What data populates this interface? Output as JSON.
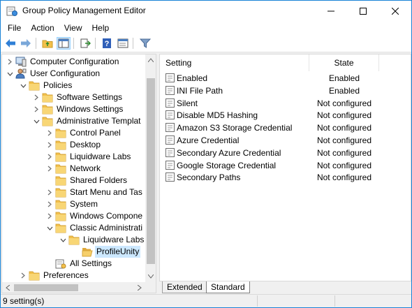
{
  "window": {
    "title": "Group Policy Management Editor",
    "icon": "gpo-editor-icon",
    "controls": [
      "minimize",
      "maximize",
      "close"
    ]
  },
  "menu": [
    "File",
    "Action",
    "View",
    "Help"
  ],
  "toolbar": {
    "buttons": [
      "back-arrow-icon",
      "forward-arrow-icon",
      "up-folder-icon",
      "show-hide-tree-icon",
      "export-list-icon",
      "help-icon",
      "properties-icon",
      "filter-icon"
    ]
  },
  "tree": {
    "items": [
      {
        "label": "Computer Configuration",
        "expanded": false,
        "icon": "computer-icon"
      },
      {
        "label": "User Configuration",
        "expanded": true,
        "icon": "user-icon"
      },
      {
        "label": "Policies",
        "expanded": true,
        "icon": "folder-icon"
      },
      {
        "label": "Software Settings",
        "expanded": false,
        "icon": "folder-icon"
      },
      {
        "label": "Windows Settings",
        "expanded": false,
        "icon": "folder-icon"
      },
      {
        "label": "Administrative Templat",
        "expanded": true,
        "icon": "folder-icon"
      },
      {
        "label": "Control Panel",
        "expanded": false,
        "icon": "folder-icon"
      },
      {
        "label": "Desktop",
        "expanded": false,
        "icon": "folder-icon"
      },
      {
        "label": "Liquidware Labs",
        "expanded": false,
        "icon": "folder-icon"
      },
      {
        "label": "Network",
        "expanded": false,
        "icon": "folder-icon"
      },
      {
        "label": "Shared Folders",
        "expanded": null,
        "icon": "folder-icon"
      },
      {
        "label": "Start Menu and Tas",
        "expanded": false,
        "icon": "folder-icon"
      },
      {
        "label": "System",
        "expanded": false,
        "icon": "folder-icon"
      },
      {
        "label": "Windows Compone",
        "expanded": false,
        "icon": "folder-icon"
      },
      {
        "label": "Classic Administrati",
        "expanded": true,
        "icon": "folder-icon"
      },
      {
        "label": "Liquidware Labs",
        "expanded": true,
        "icon": "folder-icon"
      },
      {
        "label": "ProfileUnity",
        "expanded": null,
        "icon": "folder-open-icon",
        "selected": true
      },
      {
        "label": "All Settings",
        "expanded": null,
        "icon": "all-settings-icon"
      },
      {
        "label": "Preferences",
        "expanded": false,
        "icon": "folder-icon"
      }
    ]
  },
  "list": {
    "columns": [
      "Setting",
      "State"
    ],
    "rows": [
      {
        "setting": "Enabled",
        "state": "Enabled"
      },
      {
        "setting": "INI File Path",
        "state": "Enabled"
      },
      {
        "setting": "Silent",
        "state": "Not configured"
      },
      {
        "setting": "Disable MD5 Hashing",
        "state": "Not configured"
      },
      {
        "setting": "Amazon S3 Storage Credential",
        "state": "Not configured"
      },
      {
        "setting": "Azure Credential",
        "state": "Not configured"
      },
      {
        "setting": "Secondary Azure Credential",
        "state": "Not configured"
      },
      {
        "setting": "Google Storage Credential",
        "state": "Not configured"
      },
      {
        "setting": "Secondary Paths",
        "state": "Not configured"
      }
    ]
  },
  "tabs": [
    "Extended",
    "Standard"
  ],
  "active_tab": "Standard",
  "status": "9 setting(s)",
  "colors": {
    "accent": "#1883d7",
    "selection": "#cce8ff",
    "folder": "#f3c04a"
  }
}
